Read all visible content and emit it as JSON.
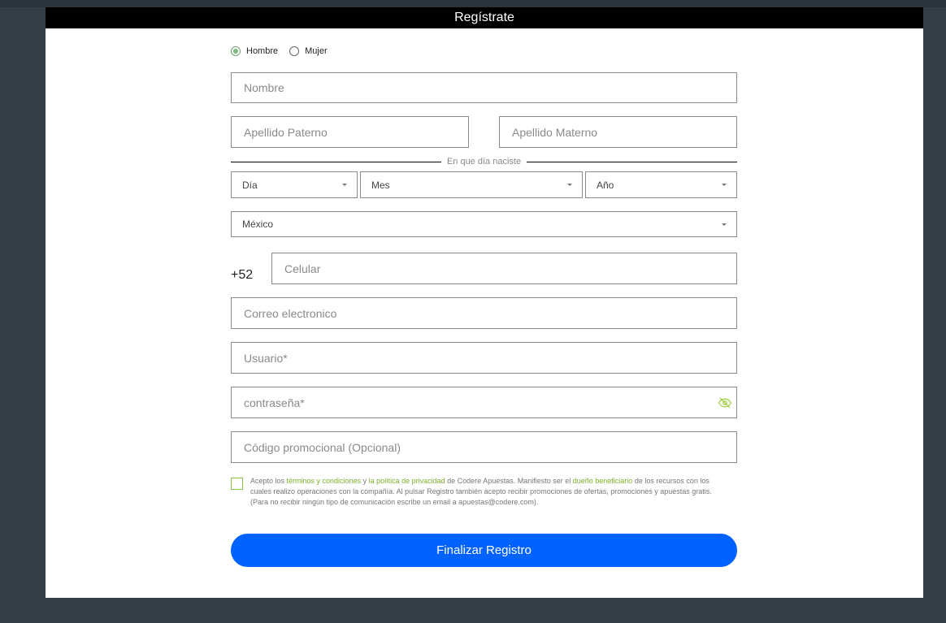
{
  "modal": {
    "title": "Regístrate"
  },
  "gender": {
    "options": [
      {
        "label": "Hombre",
        "checked": true
      },
      {
        "label": "Mujer",
        "checked": false
      }
    ]
  },
  "fields": {
    "nombre": {
      "placeholder": "Nombre",
      "value": ""
    },
    "apellido_paterno": {
      "placeholder": "Apellido Paterno",
      "value": ""
    },
    "apellido_materno": {
      "placeholder": "Apellido Materno",
      "value": ""
    },
    "celular": {
      "placeholder": "Celular",
      "value": ""
    },
    "correo": {
      "placeholder": "Correo electronico",
      "value": ""
    },
    "usuario": {
      "placeholder": "Usuario*",
      "value": ""
    },
    "contrasena": {
      "placeholder": "contraseña*",
      "value": ""
    },
    "codigo": {
      "placeholder": "Código promocional (Opcional)",
      "value": ""
    }
  },
  "birth": {
    "label": "En que día naciste",
    "day": "Día",
    "month": "Mes",
    "year": "Año"
  },
  "country": {
    "selected": "México"
  },
  "phone": {
    "prefix": "+52"
  },
  "terms": {
    "t1": "Acepto los ",
    "link1": "términos y condiciones",
    "t2": " y ",
    "link2": "la política de privacidad",
    "t3": " de Codere Apuestas. Manifiesto ser el ",
    "link3": "dueño beneficiario",
    "t4": " de los recursos con los cuales realizo operaciones con la compañía. Al pulsar Registro también acepto recibir promociones de ofertas, promociones y apuestas gratis. (Para no recibir ningún tipo de comunicación escribe un email a apuestas@codere.com)."
  },
  "submit": {
    "label": "Finalizar Registro"
  },
  "colors": {
    "primary_button": "#0062ff",
    "link_green": "#7ab02a",
    "header_bg": "#000000",
    "page_bg": "#323f48"
  },
  "icons": {
    "password_toggle": "eye-off-icon"
  }
}
